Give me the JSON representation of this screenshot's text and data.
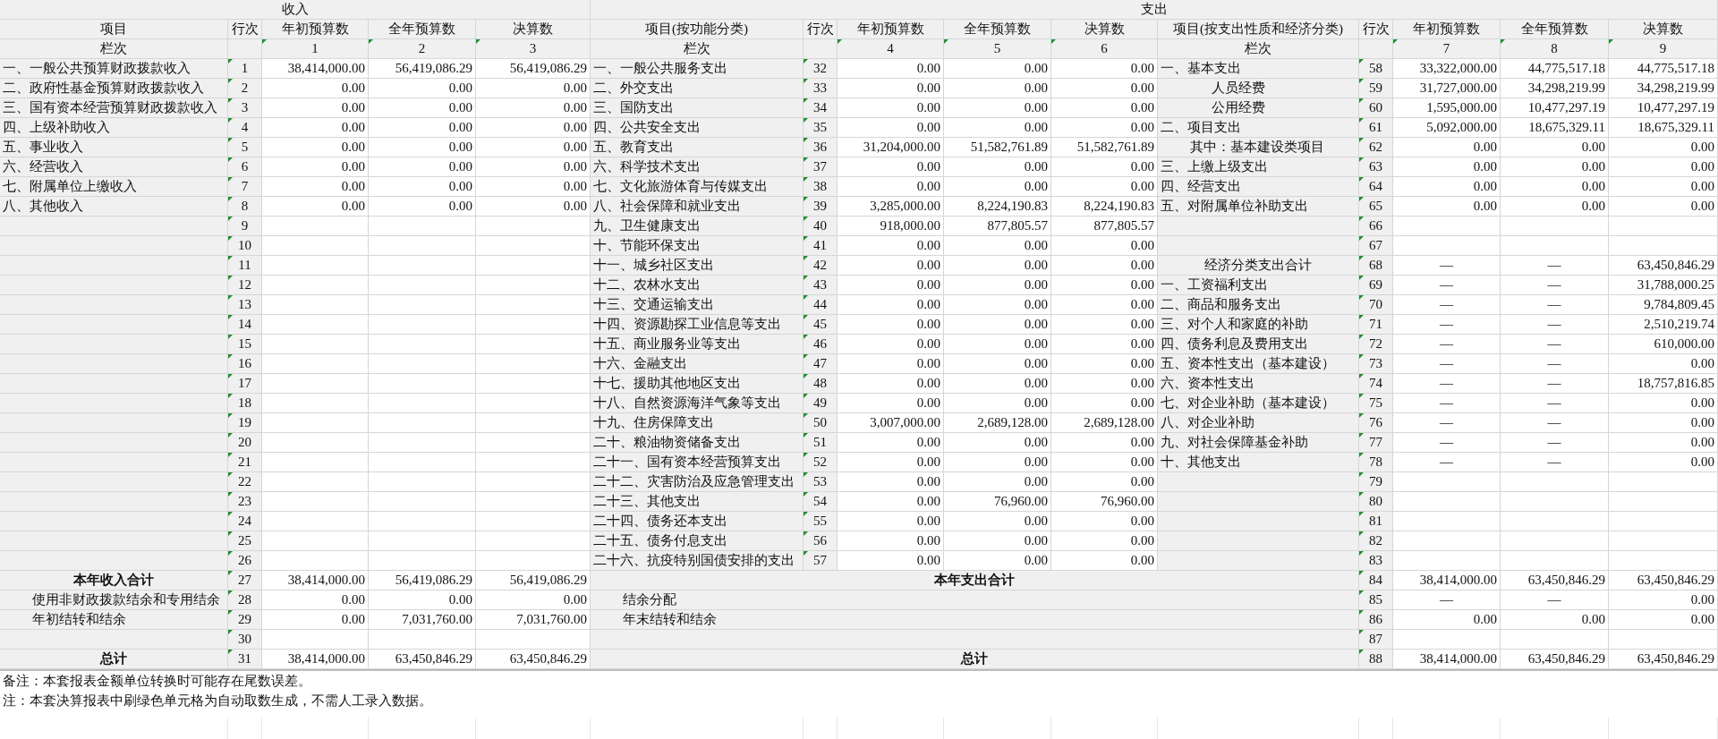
{
  "income": {
    "title": "收入",
    "columns": [
      "项目",
      "行次",
      "年初预算数",
      "全年预算数",
      "决算数"
    ],
    "numbers_label": "栏次",
    "numbers": [
      "1",
      "2",
      "3"
    ],
    "rows": [
      {
        "item": "一、一般公共预算财政拨款收入",
        "kind": "plain",
        "line": "1",
        "values": [
          "38,414,000.00",
          "56,419,086.29",
          "56,419,086.29"
        ]
      },
      {
        "item": "二、政府性基金预算财政拨款收入",
        "kind": "plain",
        "line": "2",
        "values": [
          "0.00",
          "0.00",
          "0.00"
        ]
      },
      {
        "item": "三、国有资本经营预算财政拨款收入",
        "kind": "plain",
        "line": "3",
        "values": [
          "0.00",
          "0.00",
          "0.00"
        ]
      },
      {
        "item": "四、上级补助收入",
        "kind": "plain",
        "line": "4",
        "values": [
          "0.00",
          "0.00",
          "0.00"
        ]
      },
      {
        "item": "五、事业收入",
        "kind": "plain",
        "line": "5",
        "values": [
          "0.00",
          "0.00",
          "0.00"
        ]
      },
      {
        "item": "六、经营收入",
        "kind": "plain",
        "line": "6",
        "values": [
          "0.00",
          "0.00",
          "0.00"
        ]
      },
      {
        "item": "七、附属单位上缴收入",
        "kind": "plain",
        "line": "7",
        "values": [
          "0.00",
          "0.00",
          "0.00"
        ]
      },
      {
        "item": "八、其他收入",
        "kind": "plain",
        "line": "8",
        "values": [
          "0.00",
          "0.00",
          "0.00"
        ]
      },
      {
        "line": "9"
      },
      {
        "line": "10"
      },
      {
        "line": "11"
      },
      {
        "line": "12"
      },
      {
        "line": "13"
      },
      {
        "line": "14"
      },
      {
        "line": "15"
      },
      {
        "line": "16"
      },
      {
        "line": "17"
      },
      {
        "line": "18"
      },
      {
        "line": "19"
      },
      {
        "line": "20"
      },
      {
        "line": "21"
      },
      {
        "line": "22"
      },
      {
        "line": "23"
      },
      {
        "line": "24"
      },
      {
        "line": "25"
      },
      {
        "line": "26"
      },
      {
        "item": "本年收入合计",
        "kind": "total",
        "line": "27",
        "values": [
          "38,414,000.00",
          "56,419,086.29",
          "56,419,086.29"
        ]
      },
      {
        "item": "使用非财政拨款结余和专用结余",
        "kind": "indent",
        "line": "28",
        "values": [
          "0.00",
          "0.00",
          "0.00"
        ]
      },
      {
        "item": "年初结转和结余",
        "kind": "indent",
        "line": "29",
        "values": [
          "0.00",
          "7,031,760.00",
          "7,031,760.00"
        ]
      },
      {
        "line": "30"
      },
      {
        "item": "总计",
        "kind": "total",
        "line": "31",
        "values": [
          "38,414,000.00",
          "63,450,846.29",
          "63,450,846.29"
        ]
      }
    ]
  },
  "expenditure": {
    "title": "支出",
    "by_function": {
      "columns": [
        "项目(按功能分类)",
        "行次",
        "年初预算数",
        "全年预算数",
        "决算数"
      ],
      "numbers_label": "栏次",
      "numbers": [
        "4",
        "5",
        "6"
      ],
      "rows": [
        {
          "item": "一、一般公共服务支出",
          "kind": "plain",
          "line": "32",
          "values": [
            "0.00",
            "0.00",
            "0.00"
          ]
        },
        {
          "item": "二、外交支出",
          "kind": "plain",
          "line": "33",
          "values": [
            "0.00",
            "0.00",
            "0.00"
          ]
        },
        {
          "item": "三、国防支出",
          "kind": "plain",
          "line": "34",
          "values": [
            "0.00",
            "0.00",
            "0.00"
          ]
        },
        {
          "item": "四、公共安全支出",
          "kind": "plain",
          "line": "35",
          "values": [
            "0.00",
            "0.00",
            "0.00"
          ]
        },
        {
          "item": "五、教育支出",
          "kind": "plain",
          "line": "36",
          "values": [
            "31,204,000.00",
            "51,582,761.89",
            "51,582,761.89"
          ]
        },
        {
          "item": "六、科学技术支出",
          "kind": "plain",
          "line": "37",
          "values": [
            "0.00",
            "0.00",
            "0.00"
          ]
        },
        {
          "item": "七、文化旅游体育与传媒支出",
          "kind": "plain",
          "line": "38",
          "values": [
            "0.00",
            "0.00",
            "0.00"
          ]
        },
        {
          "item": "八、社会保障和就业支出",
          "kind": "plain",
          "line": "39",
          "values": [
            "3,285,000.00",
            "8,224,190.83",
            "8,224,190.83"
          ]
        },
        {
          "item": "九、卫生健康支出",
          "kind": "plain",
          "line": "40",
          "values": [
            "918,000.00",
            "877,805.57",
            "877,805.57"
          ]
        },
        {
          "item": "十、节能环保支出",
          "kind": "plain",
          "line": "41",
          "values": [
            "0.00",
            "0.00",
            "0.00"
          ]
        },
        {
          "item": "十一、城乡社区支出",
          "kind": "plain",
          "line": "42",
          "values": [
            "0.00",
            "0.00",
            "0.00"
          ]
        },
        {
          "item": "十二、农林水支出",
          "kind": "plain",
          "line": "43",
          "values": [
            "0.00",
            "0.00",
            "0.00"
          ]
        },
        {
          "item": "十三、交通运输支出",
          "kind": "plain",
          "line": "44",
          "values": [
            "0.00",
            "0.00",
            "0.00"
          ]
        },
        {
          "item": "十四、资源勘探工业信息等支出",
          "kind": "plain",
          "line": "45",
          "values": [
            "0.00",
            "0.00",
            "0.00"
          ]
        },
        {
          "item": "十五、商业服务业等支出",
          "kind": "plain",
          "line": "46",
          "values": [
            "0.00",
            "0.00",
            "0.00"
          ]
        },
        {
          "item": "十六、金融支出",
          "kind": "plain",
          "line": "47",
          "values": [
            "0.00",
            "0.00",
            "0.00"
          ]
        },
        {
          "item": "十七、援助其他地区支出",
          "kind": "plain",
          "line": "48",
          "values": [
            "0.00",
            "0.00",
            "0.00"
          ]
        },
        {
          "item": "十八、自然资源海洋气象等支出",
          "kind": "plain",
          "line": "49",
          "values": [
            "0.00",
            "0.00",
            "0.00"
          ]
        },
        {
          "item": "十九、住房保障支出",
          "kind": "plain",
          "line": "50",
          "values": [
            "3,007,000.00",
            "2,689,128.00",
            "2,689,128.00"
          ]
        },
        {
          "item": "二十、粮油物资储备支出",
          "kind": "plain",
          "line": "51",
          "values": [
            "0.00",
            "0.00",
            "0.00"
          ]
        },
        {
          "item": "二十一、国有资本经营预算支出",
          "kind": "plain",
          "line": "52",
          "values": [
            "0.00",
            "0.00",
            "0.00"
          ]
        },
        {
          "item": "二十二、灾害防治及应急管理支出",
          "kind": "plain",
          "line": "53",
          "values": [
            "0.00",
            "0.00",
            "0.00"
          ]
        },
        {
          "item": "二十三、其他支出",
          "kind": "plain",
          "line": "54",
          "values": [
            "0.00",
            "76,960.00",
            "76,960.00"
          ]
        },
        {
          "item": "二十四、债务还本支出",
          "kind": "plain",
          "line": "55",
          "values": [
            "0.00",
            "0.00",
            "0.00"
          ]
        },
        {
          "item": "二十五、债务付息支出",
          "kind": "plain",
          "line": "56",
          "values": [
            "0.00",
            "0.00",
            "0.00"
          ]
        },
        {
          "item": "二十六、抗疫特别国债安排的支出",
          "kind": "plain",
          "line": "57",
          "values": [
            "0.00",
            "0.00",
            "0.00"
          ]
        }
      ]
    },
    "by_economic_class": {
      "columns": [
        "项目(按支出性质和经济分类)",
        "行次",
        "年初预算数",
        "全年预算数",
        "决算数"
      ],
      "numbers_label": "栏次",
      "numbers": [
        "7",
        "8",
        "9"
      ],
      "rows": [
        {
          "item": "一、基本支出",
          "kind": "plain",
          "line": "58",
          "values": [
            "33,322,000.00",
            "44,775,517.18",
            "44,775,517.18"
          ]
        },
        {
          "item": "人员经费",
          "kind": "deep",
          "line": "59",
          "values": [
            "31,727,000.00",
            "34,298,219.99",
            "34,298,219.99"
          ]
        },
        {
          "item": "公用经费",
          "kind": "deep",
          "line": "60",
          "values": [
            "1,595,000.00",
            "10,477,297.19",
            "10,477,297.19"
          ]
        },
        {
          "item": "二、项目支出",
          "kind": "plain",
          "line": "61",
          "values": [
            "5,092,000.00",
            "18,675,329.11",
            "18,675,329.11"
          ]
        },
        {
          "item": "其中：基本建设类项目",
          "kind": "indent",
          "line": "62",
          "values": [
            "0.00",
            "0.00",
            "0.00"
          ]
        },
        {
          "item": "三、上缴上级支出",
          "kind": "plain",
          "line": "63",
          "values": [
            "0.00",
            "0.00",
            "0.00"
          ]
        },
        {
          "item": "四、经营支出",
          "kind": "plain",
          "line": "64",
          "values": [
            "0.00",
            "0.00",
            "0.00"
          ]
        },
        {
          "item": "五、对附属单位补助支出",
          "kind": "plain",
          "line": "65",
          "values": [
            "0.00",
            "0.00",
            "0.00"
          ]
        },
        {
          "line": "66"
        },
        {
          "line": "67"
        },
        {
          "item": "经济分类支出合计",
          "kind": "center",
          "line": "68",
          "values": [
            "—",
            "—",
            "63,450,846.29"
          ]
        },
        {
          "item": "一、工资福利支出",
          "kind": "plain",
          "line": "69",
          "values": [
            "—",
            "—",
            "31,788,000.25"
          ]
        },
        {
          "item": "二、商品和服务支出",
          "kind": "plain",
          "line": "70",
          "values": [
            "—",
            "—",
            "9,784,809.45"
          ]
        },
        {
          "item": "三、对个人和家庭的补助",
          "kind": "plain",
          "line": "71",
          "values": [
            "—",
            "—",
            "2,510,219.74"
          ]
        },
        {
          "item": "四、债务利息及费用支出",
          "kind": "plain",
          "line": "72",
          "values": [
            "—",
            "—",
            "610,000.00"
          ]
        },
        {
          "item": "五、资本性支出（基本建设）",
          "kind": "plain",
          "line": "73",
          "values": [
            "—",
            "—",
            "0.00"
          ]
        },
        {
          "item": "六、资本性支出",
          "kind": "plain",
          "line": "74",
          "values": [
            "—",
            "—",
            "18,757,816.85"
          ]
        },
        {
          "item": "七、对企业补助（基本建设）",
          "kind": "plain",
          "line": "75",
          "values": [
            "—",
            "—",
            "0.00"
          ]
        },
        {
          "item": "八、对企业补助",
          "kind": "plain",
          "line": "76",
          "values": [
            "—",
            "—",
            "0.00"
          ]
        },
        {
          "item": "九、对社会保障基金补助",
          "kind": "plain",
          "line": "77",
          "values": [
            "—",
            "—",
            "0.00"
          ]
        },
        {
          "item": "十、其他支出",
          "kind": "plain",
          "line": "78",
          "values": [
            "—",
            "—",
            "0.00"
          ]
        },
        {
          "line": "79"
        },
        {
          "line": "80"
        },
        {
          "line": "81"
        },
        {
          "line": "82"
        },
        {
          "line": "83"
        }
      ]
    },
    "summary_rows": [
      {
        "item": "本年支出合计",
        "kind": "total",
        "line": "84",
        "values": [
          "38,414,000.00",
          "63,450,846.29",
          "63,450,846.29"
        ]
      },
      {
        "item": "结余分配",
        "kind": "indent",
        "line": "85",
        "values": [
          "—",
          "—",
          "0.00"
        ]
      },
      {
        "item": "年末结转和结余",
        "kind": "indent",
        "line": "86",
        "values": [
          "0.00",
          "0.00",
          "0.00"
        ]
      },
      {
        "line": "87"
      },
      {
        "item": "总计",
        "kind": "total",
        "line": "88",
        "values": [
          "38,414,000.00",
          "63,450,846.29",
          "63,450,846.29"
        ]
      }
    ]
  },
  "notes": [
    "备注：本套报表金额单位转换时可能存在尾数误差。",
    "注：本套决算报表中刷绿色单元格为自动取数生成，不需人工录入数据。"
  ]
}
